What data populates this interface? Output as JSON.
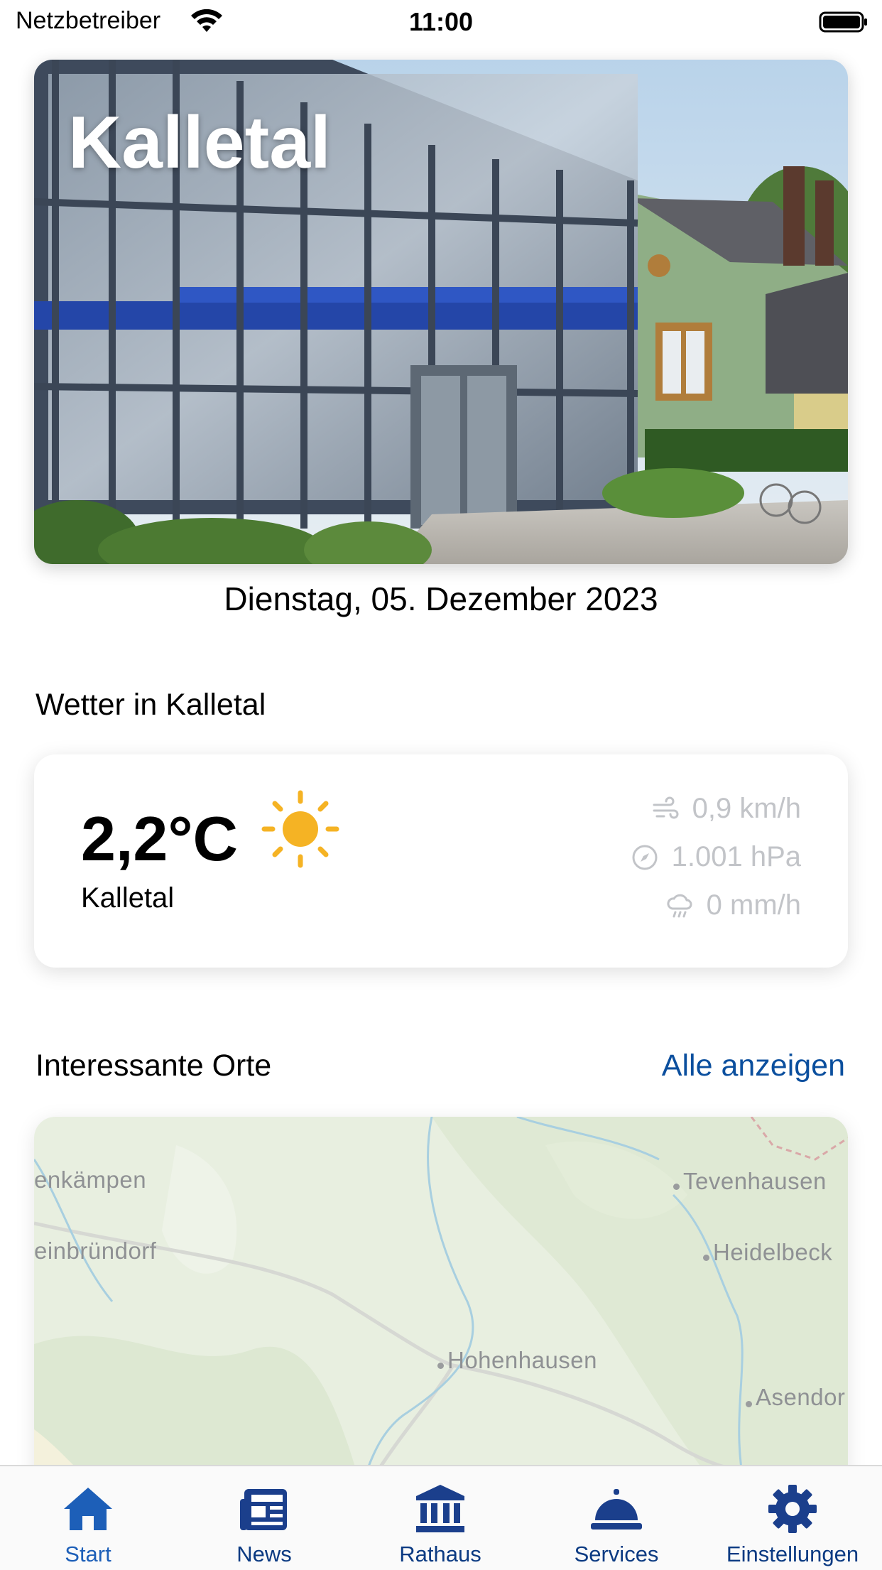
{
  "status_bar": {
    "carrier": "Netzbetreiber",
    "time": "11:00"
  },
  "hero": {
    "title": "Kalletal"
  },
  "date": "Dienstag, 05. Dezember 2023",
  "weather_section": {
    "title": "Wetter in Kalletal"
  },
  "weather": {
    "temperature": "2,2°C",
    "condition_icon": "sun-icon",
    "location": "Kalletal",
    "wind": "0,9 km/h",
    "pressure": "1.001 hPa",
    "rain": "0 mm/h"
  },
  "places_section": {
    "title": "Interessante Orte",
    "link": "Alle anzeigen"
  },
  "map": {
    "labels": [
      "enkämpen",
      "einbründorf",
      "Tevenhausen",
      "Heidelbeck",
      "Hohenhausen",
      "Asendor"
    ]
  },
  "tabs": [
    {
      "label": "Start",
      "icon": "house-icon",
      "active": true
    },
    {
      "label": "News",
      "icon": "newspaper-icon",
      "active": false
    },
    {
      "label": "Rathaus",
      "icon": "town-hall-icon",
      "active": false
    },
    {
      "label": "Services",
      "icon": "service-bell-icon",
      "active": false
    },
    {
      "label": "Einstellungen",
      "icon": "gear-icon",
      "active": false
    }
  ],
  "colors": {
    "accent": "#0b4f9e",
    "tab_icon": "#1b3f8c",
    "sun": "#f5b324",
    "muted": "#c2c4c8"
  }
}
